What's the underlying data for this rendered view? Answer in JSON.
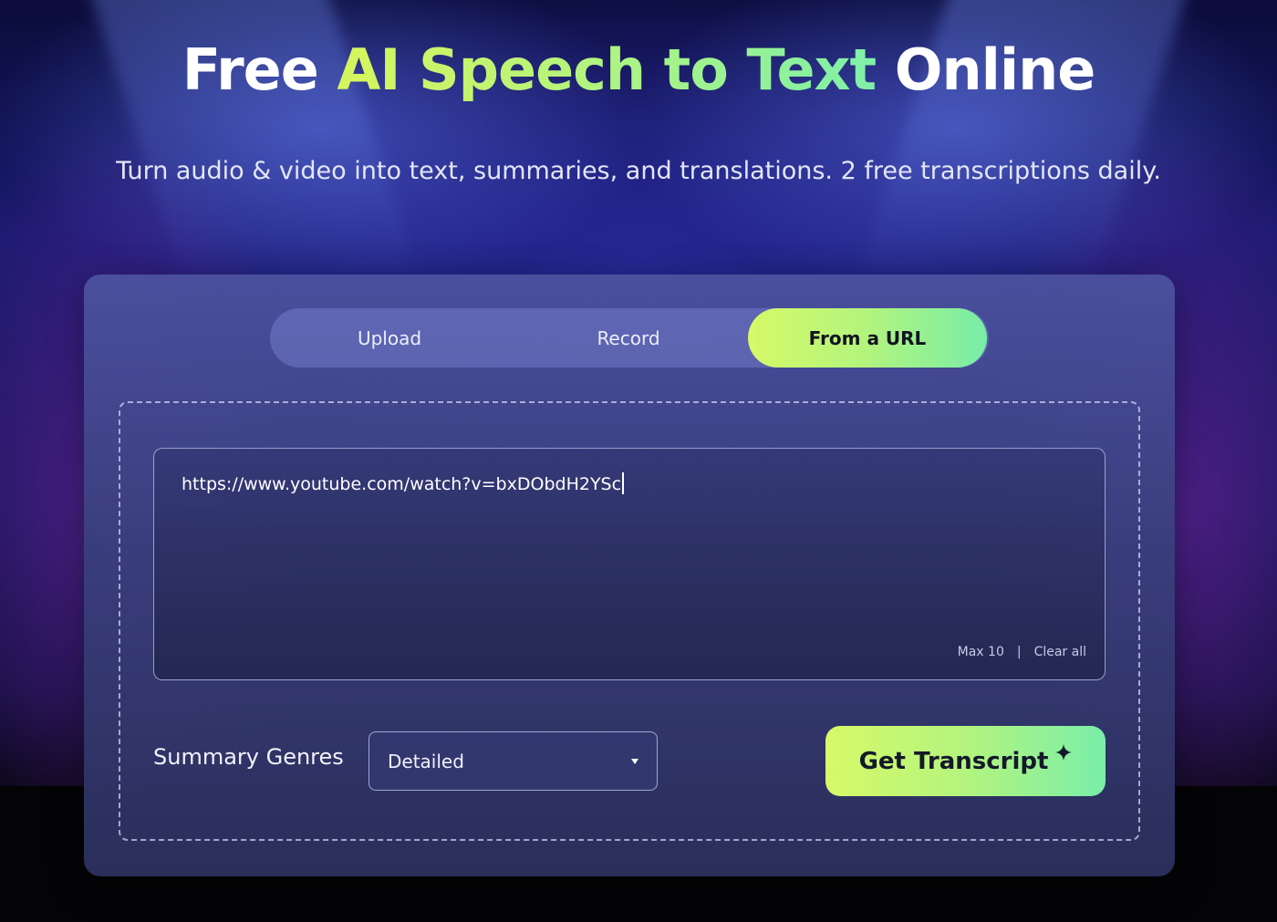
{
  "hero": {
    "title_prefix": "Free ",
    "title_highlight": "AI Speech to Text",
    "title_suffix": " Online",
    "subtitle": "Turn audio & video into text, summaries, and translations. 2 free transcriptions daily."
  },
  "tabs": [
    {
      "label": "Upload",
      "active": false
    },
    {
      "label": "Record",
      "active": false
    },
    {
      "label": "From a URL",
      "active": true
    }
  ],
  "url_input": {
    "value": "https://www.youtube.com/watch?v=bxDObdH2YSc",
    "max_label": "Max 10",
    "separator": "|",
    "clear_label": "Clear all"
  },
  "summary": {
    "label": "Summary Genres",
    "selected": "Detailed"
  },
  "action": {
    "button_label": "Get Transcript",
    "button_icon": "sparkle-icon"
  },
  "colors": {
    "accent_start": "#d6f968",
    "accent_end": "#78eda8",
    "card_bg": "#3e4384"
  }
}
